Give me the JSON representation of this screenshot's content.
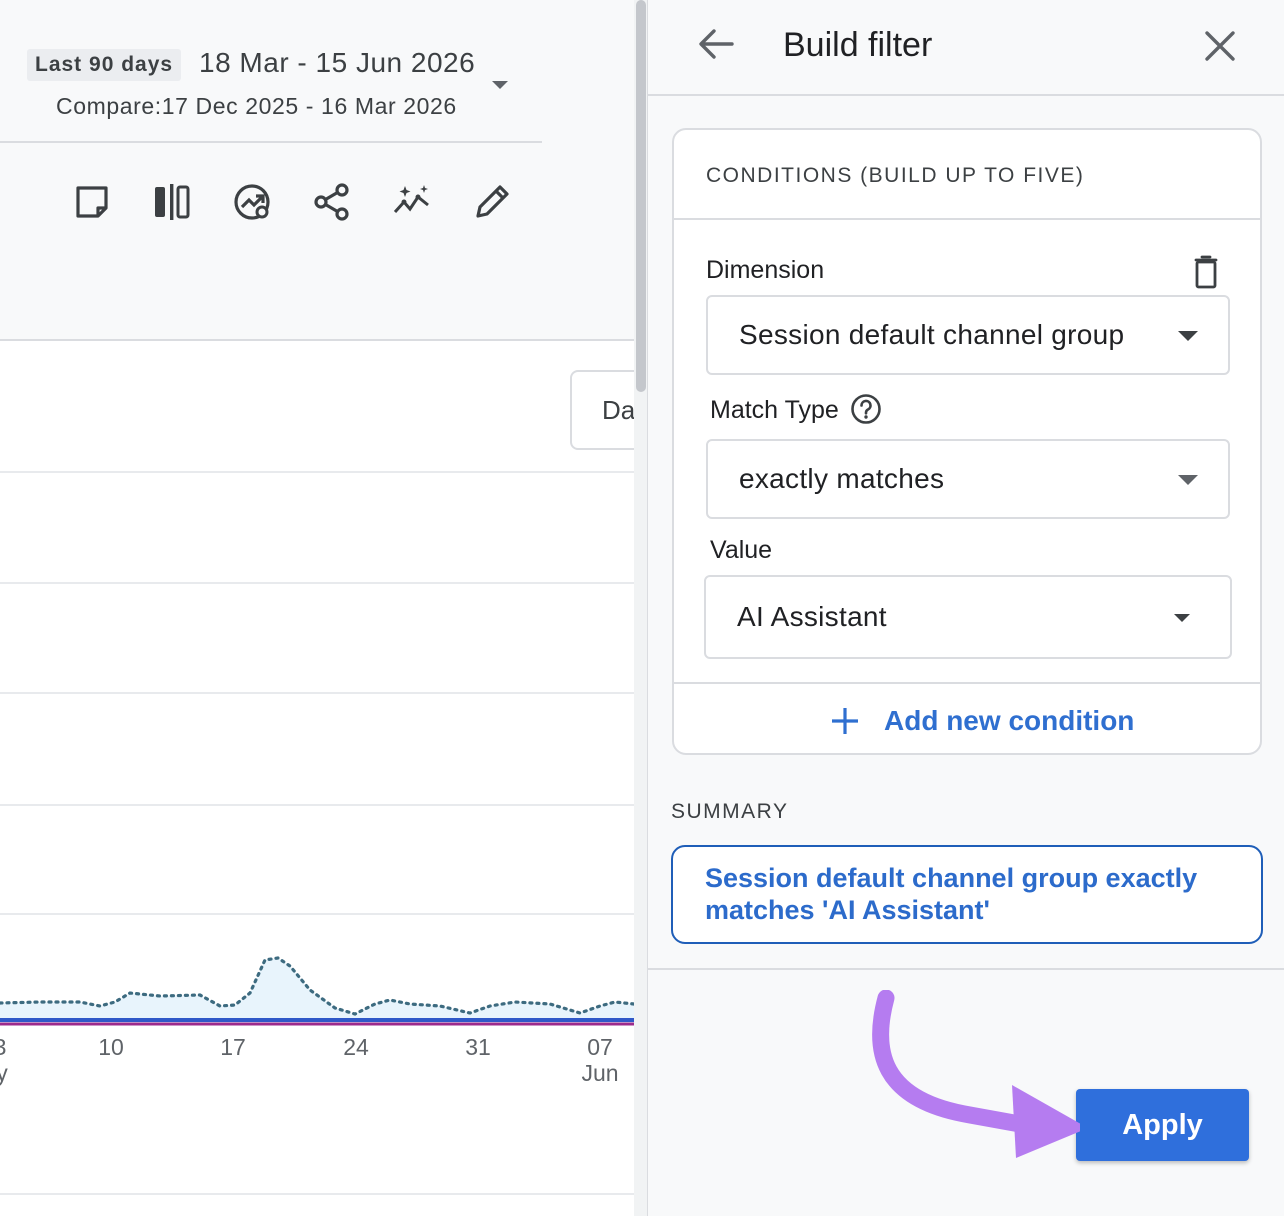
{
  "date_range": {
    "preset": "Last 90 days",
    "dates": "18 Mar - 15 Jun 2026",
    "compare": "Compare:17 Dec 2025 - 16 Mar 2026"
  },
  "toolbar_icons": [
    "note-icon",
    "compare-icon",
    "insights-icon",
    "share-icon",
    "sparkle-trend-icon",
    "edit-icon"
  ],
  "chart_button": {
    "label": "Da"
  },
  "chart_axis": {
    "ticks": [
      "3",
      "10",
      "17",
      "24",
      "31",
      "07"
    ],
    "subs": [
      "y",
      "Jun"
    ]
  },
  "panel": {
    "title": "Build filter",
    "conditions_title": "CONDITIONS (BUILD UP TO FIVE)",
    "dimension_label": "Dimension",
    "dimension_value": "Session default channel group",
    "match_type_label": "Match Type",
    "match_type_value": "exactly matches",
    "value_label": "Value",
    "value_value": "AI Assistant",
    "add_condition": "Add new condition",
    "summary_label": "SUMMARY",
    "summary_text": "Session default channel group exactly matches 'AI Assistant'",
    "apply": "Apply"
  },
  "colors": {
    "accent": "#2f6fdc",
    "annotation_arrow": "#b57cf0",
    "series_dotted": "#3d6b80",
    "series_line": "#6b3aa8"
  }
}
